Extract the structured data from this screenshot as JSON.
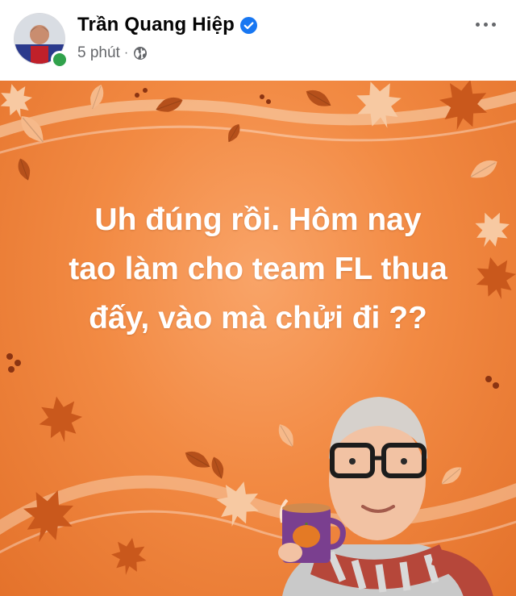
{
  "post": {
    "author": "Trần Quang Hiệp",
    "time": "5 phút",
    "separator": "·",
    "text_lines": [
      "Uh đúng rồi. Hôm nay",
      "tao làm cho team FL thua",
      "đấy, vào mà chửi đi ??"
    ],
    "background_color": "#f28a43",
    "text_color": "#ffffff"
  },
  "icons": {
    "verified": "verified-badge-icon",
    "audience": "globe-icon",
    "more": "more-options-icon",
    "online": "online-status-dot"
  },
  "colors": {
    "name": "#050505",
    "meta": "#65676b",
    "verified": "#1877f2",
    "online": "#31a24c"
  }
}
